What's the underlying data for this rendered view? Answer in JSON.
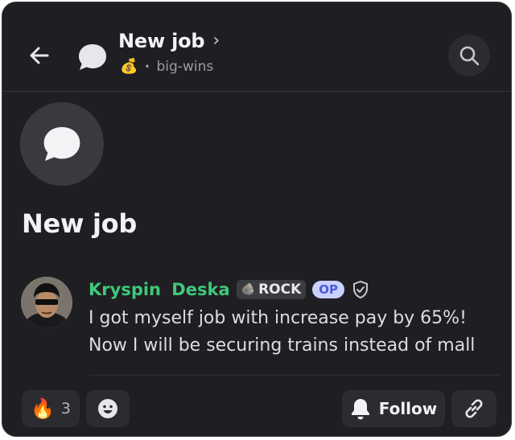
{
  "header": {
    "title": "New job",
    "title_chevron": "›",
    "channel_emoji": "💰",
    "separator": "•",
    "channel_name": "big-wins"
  },
  "thread": {
    "title": "New job"
  },
  "message": {
    "author": "Kryspin Deska",
    "role_tag_emoji": "🪨",
    "role_tag_label": "ROCK",
    "op_badge": "OP",
    "lines": [
      "I got myself job with increase pay by 65%!",
      "Now I will be securing trains instead of mall"
    ]
  },
  "footer": {
    "reaction_emoji": "🔥",
    "reaction_count": "3",
    "follow_label": "Follow"
  },
  "colors": {
    "background": "#1f1f23",
    "author_green": "#3fc97a",
    "op_badge_bg": "#c9d1ff",
    "op_badge_text": "#4c5bd9"
  },
  "icons": [
    "back-arrow-icon",
    "thread-bubble-icon",
    "search-icon",
    "shield-check-icon",
    "smiley-icon",
    "bell-icon",
    "link-icon"
  ]
}
